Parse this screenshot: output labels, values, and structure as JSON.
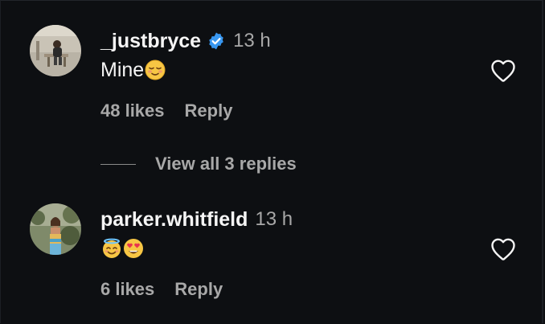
{
  "comments": [
    {
      "username": "_justbryce",
      "verified": true,
      "time": "13 h",
      "text": "Mine",
      "emojis": [
        "relieved-face-emoji"
      ],
      "likes": "48 likes",
      "reply": "Reply",
      "view_replies": "View all 3 replies"
    },
    {
      "username": "parker.whitfield",
      "verified": false,
      "time": "13 h",
      "text": "",
      "emojis": [
        "smiling-face-with-halo-emoji",
        "heart-eyes-emoji"
      ],
      "likes": "6 likes",
      "reply": "Reply"
    }
  ],
  "colors": {
    "background": "#0d0f12",
    "primary_text": "#f5f5f5",
    "secondary_text": "#a8a8a8",
    "verified_badge": "#3897f0"
  },
  "icons": {
    "like": "heart-outline-icon",
    "verified": "verified-badge-icon"
  }
}
